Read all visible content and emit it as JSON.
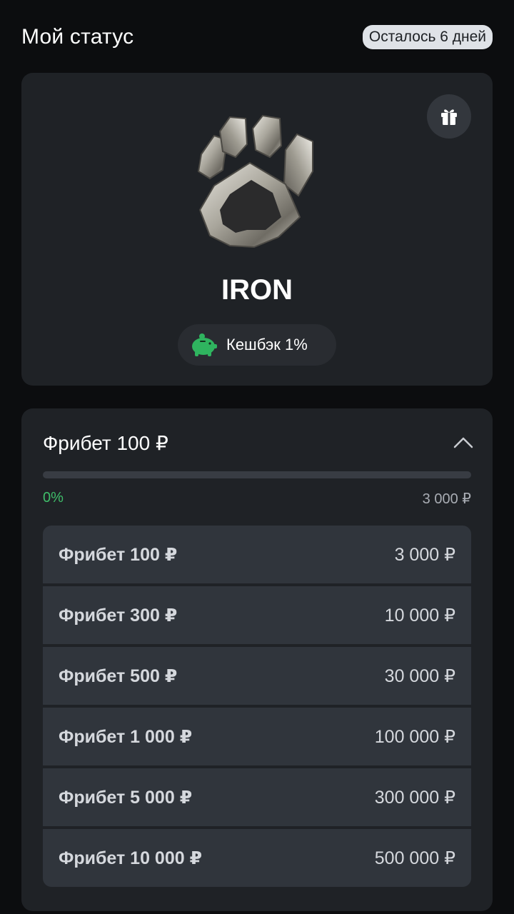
{
  "header": {
    "title": "Мой статус",
    "days_left": "Осталось 6 дней"
  },
  "status": {
    "level": "IRON",
    "badge_icon": "iron-paw-badge",
    "gift_icon": "gift-icon",
    "cashback_icon": "piggy-bank-icon",
    "cashback_label": "Кешбэк 1%"
  },
  "freebet": {
    "title": "Фрибет 100 ₽",
    "collapse_icon": "chevron-up-icon",
    "progress": 0,
    "progress_label": "0%",
    "target_label": "3 000 ₽",
    "levels": [
      {
        "name": "Фрибет 100 ₽",
        "amount": "3 000 ₽"
      },
      {
        "name": "Фрибет 300 ₽",
        "amount": "10 000 ₽"
      },
      {
        "name": "Фрибет 500 ₽",
        "amount": "30 000 ₽"
      },
      {
        "name": "Фрибет 1 000 ₽",
        "amount": "100 000 ₽"
      },
      {
        "name": "Фрибет 5 000 ₽",
        "amount": "300 000 ₽"
      },
      {
        "name": "Фрибет 10 000 ₽",
        "amount": "500 000 ₽"
      }
    ]
  },
  "colors": {
    "accent_green": "#3fbe6a",
    "background": "#0c0d0f",
    "card": "#1f2226",
    "row": "#30353c"
  }
}
